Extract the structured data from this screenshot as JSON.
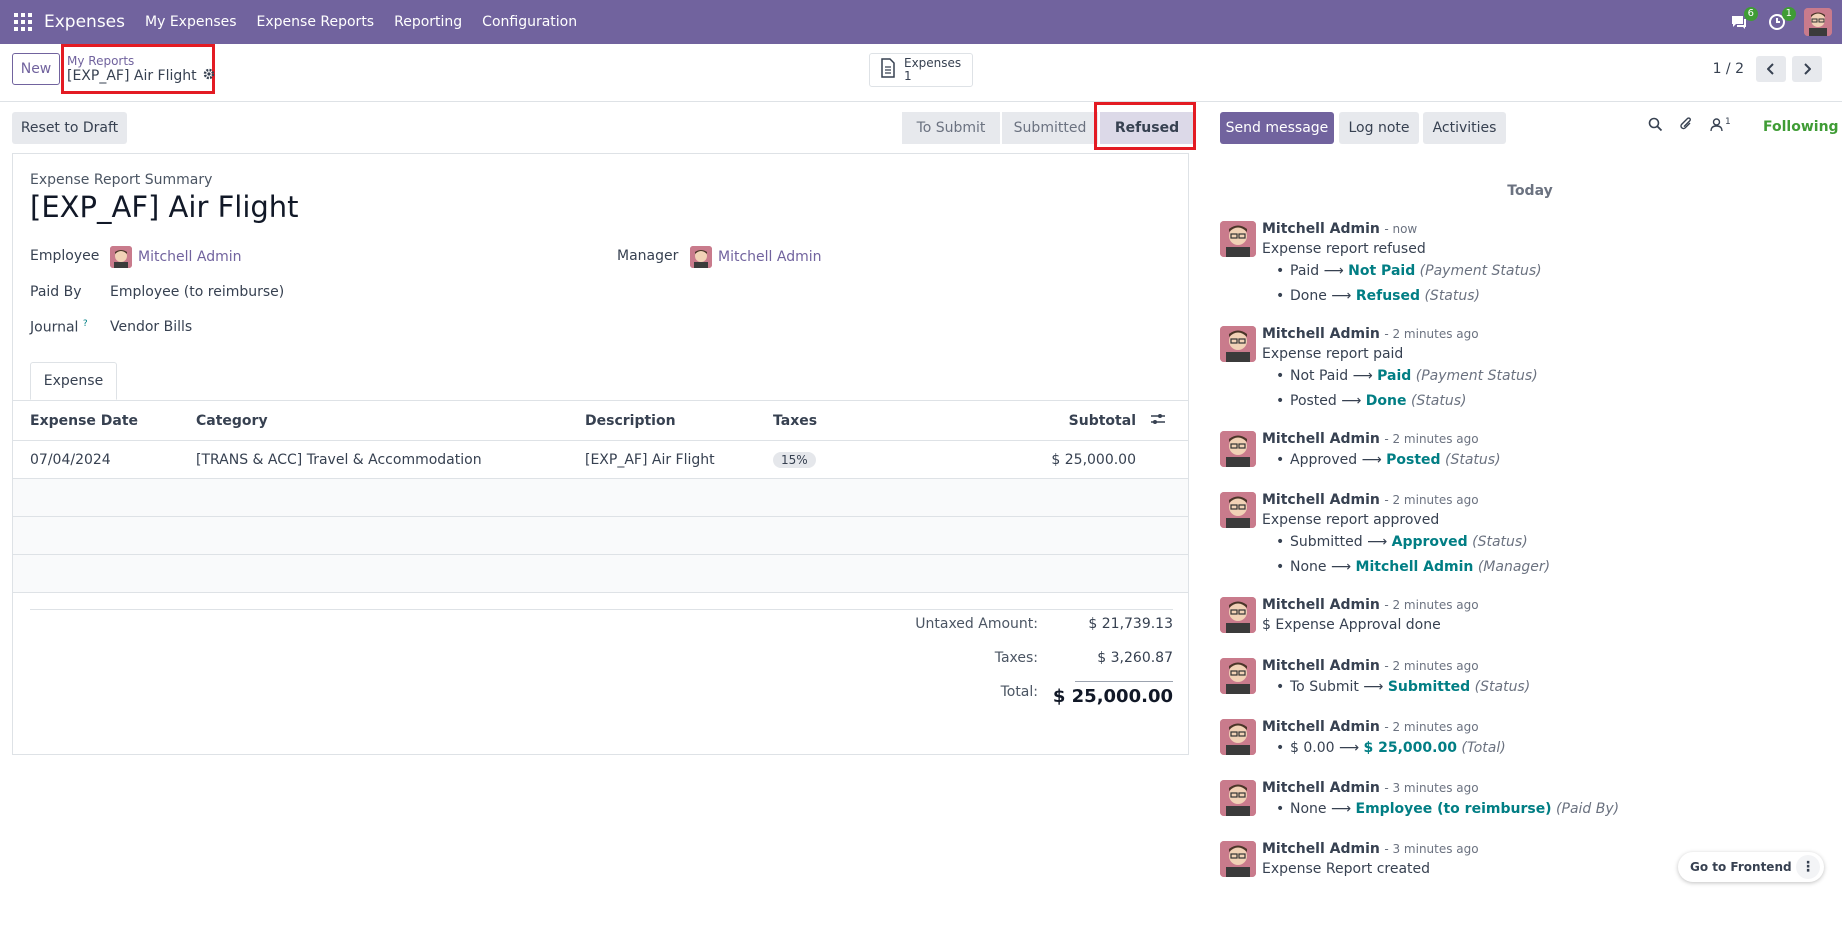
{
  "navbar": {
    "app_name": "Expenses",
    "menu": [
      "My Expenses",
      "Expense Reports",
      "Reporting",
      "Configuration"
    ],
    "messages_count": "6",
    "activities_count": "1"
  },
  "control": {
    "new_label": "New",
    "breadcrumb_parent": "My Reports",
    "breadcrumb_current": "[EXP_AF] Air Flight",
    "stat_label": "Expenses",
    "stat_value": "1",
    "pager": "1 / 2"
  },
  "status": {
    "reset_label": "Reset to Draft",
    "stages": [
      "To Submit",
      "Submitted",
      "Refused"
    ],
    "current_stage": "Refused"
  },
  "form": {
    "summary_label": "Expense Report Summary",
    "title": "[EXP_AF] Air Flight",
    "employee_label": "Employee",
    "employee": "Mitchell Admin",
    "manager_label": "Manager",
    "manager": "Mitchell Admin",
    "paid_by_label": "Paid By",
    "paid_by": "Employee (to reimburse)",
    "journal_label": "Journal",
    "journal_help": "?",
    "journal": "Vendor Bills",
    "tab_label": "Expense"
  },
  "table": {
    "columns": [
      "Expense Date",
      "Category",
      "Description",
      "Taxes",
      "Subtotal"
    ],
    "rows": [
      [
        "07/04/2024",
        "[TRANS & ACC] Travel & Accommodation",
        "[EXP_AF] Air Flight",
        "15%",
        "$ 25,000.00"
      ]
    ]
  },
  "totals": {
    "untaxed_label": "Untaxed Amount:",
    "untaxed": "$ 21,739.13",
    "taxes_label": "Taxes:",
    "taxes": "$ 3,260.87",
    "total_label": "Total:",
    "total": "$ 25,000.00"
  },
  "chatter": {
    "send_label": "Send message",
    "log_label": "Log note",
    "activities_label": "Activities",
    "followers_count": "1",
    "following_label": "Following",
    "today_label": "Today",
    "messages": [
      {
        "author": "Mitchell Admin",
        "time": "- now",
        "body": "Expense report refused",
        "tracks": [
          {
            "from": "Paid",
            "to": "Not Paid",
            "field": "(Payment Status)"
          },
          {
            "from": "Done",
            "to": "Refused",
            "field": "(Status)"
          }
        ]
      },
      {
        "author": "Mitchell Admin",
        "time": "- 2 minutes ago",
        "body": "Expense report paid",
        "tracks": [
          {
            "from": "Not Paid",
            "to": "Paid",
            "field": "(Payment Status)"
          },
          {
            "from": "Posted",
            "to": "Done",
            "field": "(Status)"
          }
        ]
      },
      {
        "author": "Mitchell Admin",
        "time": "- 2 minutes ago",
        "body": "",
        "tracks": [
          {
            "from": "Approved",
            "to": "Posted",
            "field": "(Status)"
          }
        ]
      },
      {
        "author": "Mitchell Admin",
        "time": "- 2 minutes ago",
        "body": "Expense report approved",
        "tracks": [
          {
            "from": "Submitted",
            "to": "Approved",
            "field": "(Status)"
          },
          {
            "from": "None",
            "to": "Mitchell Admin",
            "field": "(Manager)"
          }
        ]
      },
      {
        "author": "Mitchell Admin",
        "time": "- 2 minutes ago",
        "body": "$ Expense Approval done",
        "tracks": []
      },
      {
        "author": "Mitchell Admin",
        "time": "- 2 minutes ago",
        "body": "",
        "tracks": [
          {
            "from": "To Submit",
            "to": "Submitted",
            "field": "(Status)"
          }
        ]
      },
      {
        "author": "Mitchell Admin",
        "time": "- 2 minutes ago",
        "body": "",
        "tracks": [
          {
            "from": "$ 0.00",
            "to": "$ 25,000.00",
            "field": "(Total)"
          }
        ]
      },
      {
        "author": "Mitchell Admin",
        "time": "- 3 minutes ago",
        "body": "",
        "tracks": [
          {
            "from": "None",
            "to": "Employee (to reimburse)",
            "field": "(Paid By)"
          }
        ]
      },
      {
        "author": "Mitchell Admin",
        "time": "- 3 minutes ago",
        "body": "Expense Report created",
        "tracks": []
      }
    ]
  },
  "frontend_label": "Go to Frontend",
  "colors": {
    "brand": "#71639e",
    "accent_link": "#017e84",
    "following": "#3f9c35",
    "highlight": "#e31b23"
  },
  "icons": [
    "apps-grid-icon",
    "chat-icon",
    "clock-icon",
    "user-avatar",
    "gear-icon",
    "document-icon",
    "chevron-left-icon",
    "chevron-right-icon",
    "column-options-icon",
    "search-icon",
    "paperclip-icon",
    "followers-icon",
    "more-dots-icon"
  ]
}
